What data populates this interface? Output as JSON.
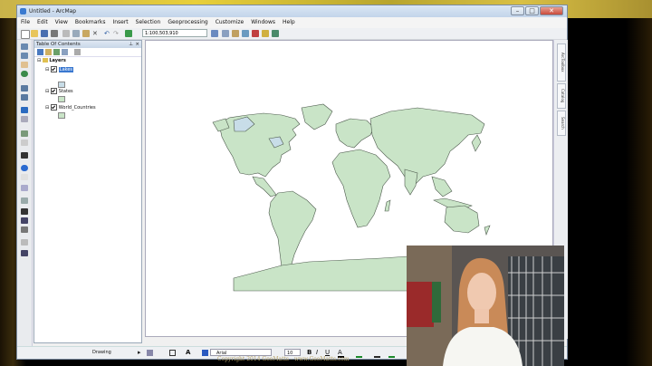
{
  "window": {
    "title": "Untitled - ArcMap"
  },
  "menu": [
    "File",
    "Edit",
    "View",
    "Bookmarks",
    "Insert",
    "Selection",
    "Geoprocessing",
    "Customize",
    "Windows",
    "Help"
  ],
  "toolbar": {
    "scale": "1:100,503,910"
  },
  "toc": {
    "title": "Table Of Contents",
    "root": "Layers",
    "layers": [
      {
        "name": "Lakes",
        "swatch": "#c8dde8",
        "selected": true
      },
      {
        "name": "States",
        "swatch": "#c9e4c7",
        "selected": false
      },
      {
        "name": "World_Countries",
        "swatch": "#c9e4c7",
        "selected": false
      }
    ]
  },
  "right_dock": [
    "ArcToolbox",
    "Catalog",
    "Search"
  ],
  "draw_toolbar": {
    "label": "Drawing",
    "font": "Arial",
    "size": "10"
  },
  "footer": {
    "copyright": "Copyright 2014 GeoMatts - www.GeoMatts.com"
  },
  "colors": {
    "land": "#c9e4c7",
    "water": "#c8dde8",
    "outline": "#4d5a4d",
    "window_frame": "#7a8aa0"
  }
}
